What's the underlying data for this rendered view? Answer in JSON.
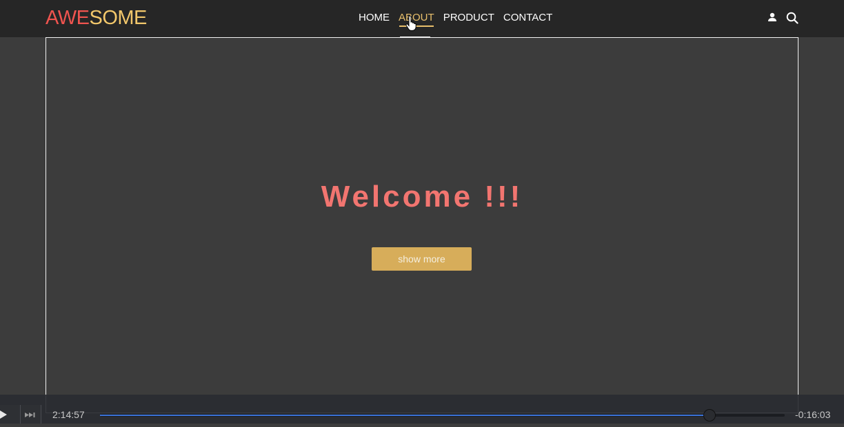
{
  "header": {
    "logo_part1": "AWE",
    "logo_part2": "SOME",
    "nav": [
      {
        "label": "HOME",
        "active": false
      },
      {
        "label": "ABOUT",
        "active": true
      },
      {
        "label": "PRODUCT",
        "active": false
      },
      {
        "label": "CONTACT",
        "active": false
      }
    ],
    "icons": [
      "user-icon",
      "search-icon"
    ]
  },
  "hero": {
    "title": "Welcome !!!",
    "button_label": "show more"
  },
  "player": {
    "current_time": "2:14:57",
    "remaining_time": "-0:16:03",
    "progress": 0.89
  },
  "colors": {
    "logo_red": "#f0544f",
    "logo_gold": "#f2c76b",
    "accent": "#e9c06c",
    "welcome": "#f27570",
    "button": "#d7ad5a"
  }
}
